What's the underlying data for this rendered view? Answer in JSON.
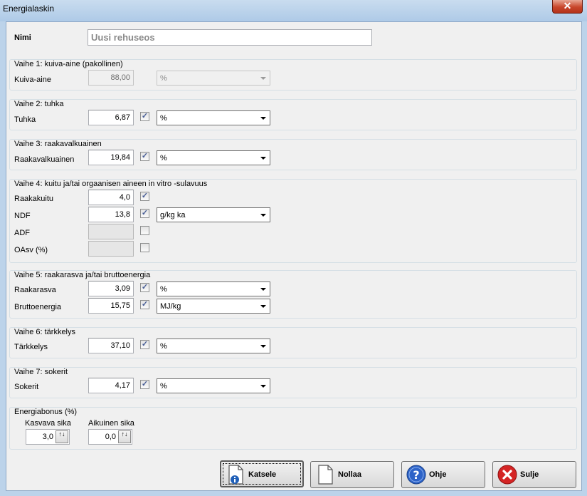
{
  "window": {
    "title": "Energialaskin",
    "close_symbol": "✕"
  },
  "name_field": {
    "label": "Nimi",
    "value": "Uusi rehuseos"
  },
  "vaihe1": {
    "title": "Vaihe 1: kuiva-aine (pakollinen)",
    "rows": [
      {
        "label": "Kuiva-aine",
        "value": "88,00",
        "unit": "%"
      }
    ]
  },
  "vaihe2": {
    "title": "Vaihe 2: tuhka",
    "rows": [
      {
        "label": "Tuhka",
        "value": "6,87",
        "unit": "%"
      }
    ]
  },
  "vaihe3": {
    "title": "Vaihe 3: raakavalkuainen",
    "rows": [
      {
        "label": "Raakavalkuainen",
        "value": "19,84",
        "unit": "%"
      }
    ]
  },
  "vaihe4": {
    "title": "Vaihe 4: kuitu ja/tai orgaanisen aineen in vitro -sulavuus",
    "rows": [
      {
        "label": "Raakakuitu",
        "value": "4,0"
      },
      {
        "label": "NDF",
        "value": "13,8",
        "unit": "g/kg ka"
      },
      {
        "label": "ADF",
        "value": ""
      },
      {
        "label": "OAsv (%)",
        "value": ""
      }
    ]
  },
  "vaihe5": {
    "title": "Vaihe 5: raakarasva ja/tai bruttoenergia",
    "rows": [
      {
        "label": "Raakarasva",
        "value": "3,09",
        "unit": "%"
      },
      {
        "label": "Bruttoenergia",
        "value": "15,75",
        "unit": "MJ/kg"
      }
    ]
  },
  "vaihe6": {
    "title": "Vaihe 6: tärkkelys",
    "rows": [
      {
        "label": "Tärkkelys",
        "value": "37,10",
        "unit": "%"
      }
    ]
  },
  "vaihe7": {
    "title": "Vaihe 7: sokerit",
    "rows": [
      {
        "label": "Sokerit",
        "value": "4,17",
        "unit": "%"
      }
    ]
  },
  "energiabonus": {
    "title": "Energiabonus (%)",
    "kasvava": {
      "label": "Kasvava sika",
      "value": "3,0"
    },
    "aikuinen": {
      "label": "Aikuinen sika",
      "value": "0,0"
    }
  },
  "checkbox_mark": "✓",
  "spin_symbol": "↑↓",
  "buttons": {
    "katsele": "Katsele",
    "nollaa": "Nollaa",
    "ohje": "Ohje",
    "sulje": "Sulje"
  },
  "colors": {
    "info_blue": "#1f5fb8",
    "help_blue": "#2d63c8",
    "close_red": "#d42424"
  }
}
